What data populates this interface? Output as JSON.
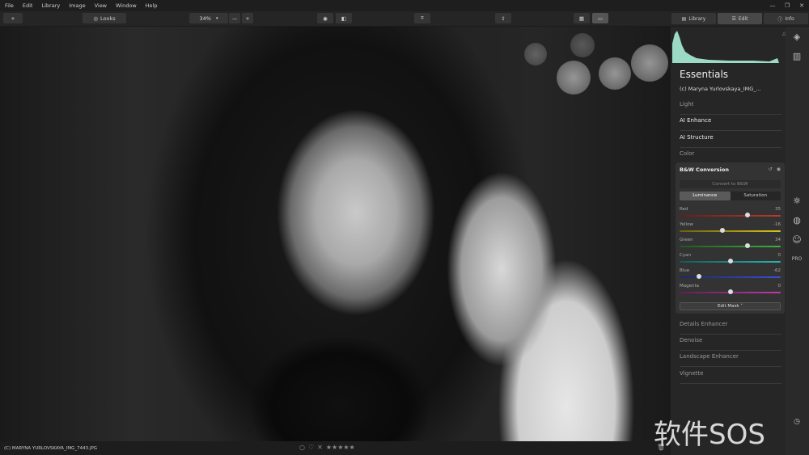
{
  "menu": [
    "File",
    "Edit",
    "Library",
    "Image",
    "View",
    "Window",
    "Help"
  ],
  "toolbar": {
    "add_label": "+",
    "looks_label": "Looks",
    "zoom_value": "34%",
    "zoom_out": "—",
    "zoom_in": "+"
  },
  "panel_tabs": [
    {
      "label": "Library",
      "icon": "library-icon"
    },
    {
      "label": "Edit",
      "icon": "sliders-icon"
    },
    {
      "label": "Info",
      "icon": "info-icon"
    }
  ],
  "essentials": {
    "title": "Essentials",
    "subtitle": "(c) Maryna Yurlovskaya_IMG_..."
  },
  "sections_top": [
    "Light",
    "AI Enhance",
    "AI Structure",
    "Color"
  ],
  "bw": {
    "title": "B&W Conversion",
    "convert_label": "Convert to B&W",
    "tab_luminance": "Luminance",
    "tab_saturation": "Saturation",
    "sliders": [
      {
        "label": "Red",
        "value": "35",
        "level": 0.675
      },
      {
        "label": "Yellow",
        "value": "-16",
        "level": 0.42
      },
      {
        "label": "Green",
        "value": "34",
        "level": 0.67
      },
      {
        "label": "Cyan",
        "value": "0",
        "level": 0.5
      },
      {
        "label": "Blue",
        "value": "-62",
        "level": 0.19
      },
      {
        "label": "Magenta",
        "value": "0",
        "level": 0.5
      }
    ],
    "edit_mask": "Edit Mask ˅"
  },
  "sections_bottom": [
    "Details Enhancer",
    "Denoise",
    "Landscape Enhancer",
    "Vignette"
  ],
  "rail_pro": "PRO",
  "status": {
    "filename": "(C) MARYNA YURLOVSKAYA_IMG_7443.JPG",
    "stars": "★★★★★"
  },
  "watermark": "软件SOS",
  "colors": {
    "histogram": "#a8f0d8",
    "accent_red": "#c0392b",
    "accent_yellow": "#d4c21a",
    "accent_green": "#3fae3f",
    "accent_cyan": "#2bb3b3",
    "accent_blue": "#3a4fd6",
    "accent_magenta": "#c23aa8"
  }
}
